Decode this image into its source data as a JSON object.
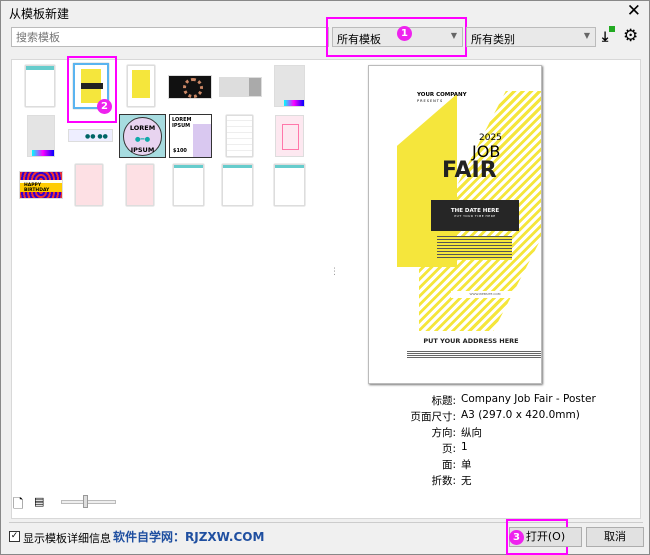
{
  "window": {
    "title": "从模板新建",
    "close": "✕"
  },
  "search": {
    "placeholder": "搜索模板"
  },
  "filters": {
    "templates": "所有模板",
    "categories": "所有类别",
    "badge1": "1"
  },
  "grid": {
    "badge2": "2",
    "lorem": "LOREM",
    "ipsum": "IPSUM",
    "lorem_ipsum": "LOREM IPSUM",
    "price": "$100",
    "birthday": "HAPPY BIRTHDAY"
  },
  "preview": {
    "company": "YOUR COMPANY",
    "presents": "PRESENTS",
    "year": "2025",
    "job": "JOB",
    "fair": "FAIR",
    "date": "THE DATE HERE",
    "time": "PUT YOUR TIME HERE",
    "website": "WWW.WEBSITE.COM",
    "address": "PUT YOUR ADDRESS HERE"
  },
  "details": [
    {
      "label": "标题:",
      "value": "Company Job Fair - Poster"
    },
    {
      "label": "页面尺寸:",
      "value": "A3 (297.0 x 420.0mm)"
    },
    {
      "label": "方向:",
      "value": "纵向"
    },
    {
      "label": "页:",
      "value": "1"
    },
    {
      "label": "面:",
      "value": "单"
    },
    {
      "label": "折数:",
      "value": "无"
    }
  ],
  "footer": {
    "show_details": "显示模板详细信息",
    "checked": true,
    "watermark": "软件自学网：RJZXW.COM",
    "open": "打开(O)",
    "cancel": "取消",
    "badge3": "3"
  },
  "colors": {
    "highlight": "#ff00ff",
    "accent_yellow": "#f5e63c",
    "watermark": "#1f4fa0"
  }
}
